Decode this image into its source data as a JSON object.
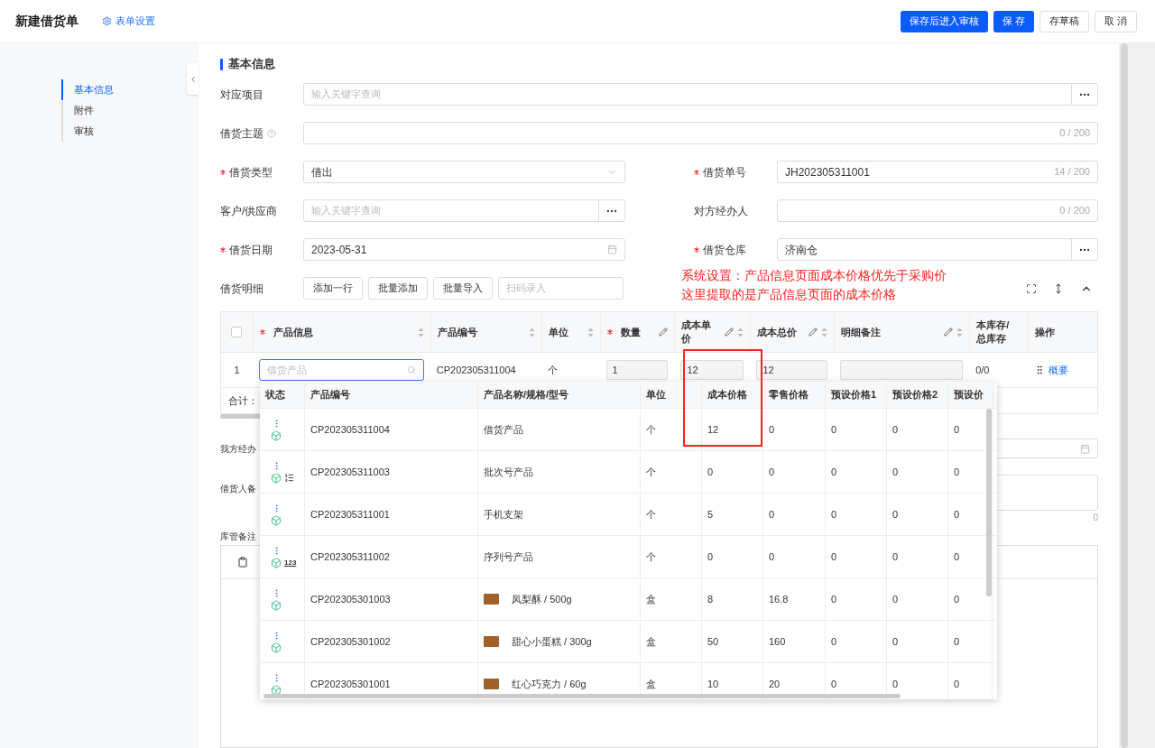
{
  "header": {
    "title": "新建借货单",
    "settings_link": "表单设置",
    "buttons": [
      {
        "label": "保存后进入审核",
        "kind": "primary"
      },
      {
        "label": "保 存",
        "kind": "primary"
      },
      {
        "label": "存草稿",
        "kind": "default"
      },
      {
        "label": "取 消",
        "kind": "default"
      }
    ]
  },
  "nav": {
    "items": [
      {
        "label": "基本信息",
        "selected": true
      },
      {
        "label": "附件",
        "selected": false
      },
      {
        "label": "审核",
        "selected": false
      }
    ]
  },
  "section_title": "基本信息",
  "project": {
    "label": "对应项目",
    "placeholder": "输入关键字查询"
  },
  "subject": {
    "label": "借货主题",
    "counter": "0 / 200"
  },
  "type": {
    "label": "借货类型",
    "required": true,
    "value": "借出"
  },
  "number": {
    "label": "借货单号",
    "required": true,
    "value": "JH202305311001",
    "counter": "14 / 200"
  },
  "customer": {
    "label": "客户/供应商",
    "required": false,
    "placeholder": "输入关键字查询"
  },
  "counterpart": {
    "label": "对方经办人",
    "required": false,
    "counter": "0 / 200"
  },
  "date": {
    "label": "借货日期",
    "required": true,
    "value": "2023-05-31"
  },
  "warehouse": {
    "label": "借货仓库",
    "required": true,
    "value": "济南仓"
  },
  "details": {
    "label": "借货明细",
    "buttons": [
      "添加一行",
      "批量添加",
      "批量导入"
    ],
    "scan_placeholder": "扫码录入"
  },
  "note": {
    "lines": [
      "系统设置：产品信息页面成本价格优先于采购价",
      "这里提取的是产品信息页面的成本价格"
    ]
  },
  "items_table": {
    "header_checkbox": {
      "checked": false
    },
    "columns": [
      {
        "label": "产品信息",
        "required": true,
        "sortable": true,
        "editable": false
      },
      {
        "label": "产品编号",
        "required": false,
        "sortable": true,
        "editable": false
      },
      {
        "label": "单位",
        "required": false,
        "sortable": true,
        "editable": false
      },
      {
        "label": "数量",
        "required": true,
        "sortable": false,
        "editable": true
      },
      {
        "label": "成本单价",
        "required": false,
        "sortable": true,
        "editable": true
      },
      {
        "label": "成本总价",
        "required": false,
        "sortable": true,
        "editable": true
      },
      {
        "label": "明细备注",
        "required": false,
        "sortable": true,
        "editable": true
      },
      {
        "label": "本库存/总库存",
        "required": false,
        "sortable": false,
        "editable": false
      },
      {
        "label": "操作",
        "required": false,
        "sortable": false,
        "editable": false
      }
    ],
    "rows": [
      {
        "index": "1",
        "product_placeholder": "借货产品",
        "code": "CP202305311004",
        "unit": "个",
        "quantity": "1",
        "unit_cost": "12",
        "total_cost": "12",
        "stock": "0/0",
        "action": "概要"
      }
    ],
    "total_label": "合计："
  },
  "our_handler": {
    "label": "我方经办"
  },
  "borrower_note": {
    "label": "借货人备",
    "counter": "0"
  },
  "keeper_note": {
    "label": "库管备注"
  },
  "picker": {
    "columns": [
      "状态",
      "产品编号",
      "产品名称/规格/型号",
      "单位",
      "成本价格",
      "零售价格",
      "预设价格1",
      "预设价格2",
      "预设价"
    ],
    "rows": [
      {
        "code": "CP202305311004",
        "name": "借货产品",
        "image": false,
        "unit": "个",
        "cost": "12",
        "retail": "0",
        "preset1": "0",
        "preset2": "0",
        "preset3": "0",
        "badge": {
          "kind": "none"
        }
      },
      {
        "code": "CP202305311003",
        "name": "批次号产品",
        "image": false,
        "unit": "个",
        "cost": "0",
        "retail": "0",
        "preset1": "0",
        "preset2": "0",
        "preset3": "0",
        "badge": {
          "kind": "batch"
        }
      },
      {
        "code": "CP202305311001",
        "name": "手机支架",
        "image": false,
        "unit": "个",
        "cost": "5",
        "retail": "0",
        "preset1": "0",
        "preset2": "0",
        "preset3": "0",
        "badge": {
          "kind": "none"
        }
      },
      {
        "code": "CP202305311002",
        "name": "序列号产品",
        "image": false,
        "unit": "个",
        "cost": "0",
        "retail": "0",
        "preset1": "0",
        "preset2": "0",
        "preset3": "0",
        "badge": {
          "kind": "serial",
          "text": "123"
        }
      },
      {
        "code": "CP202305301003",
        "name": "凤梨酥 / 500g",
        "image": true,
        "unit": "盒",
        "cost": "8",
        "retail": "16.8",
        "preset1": "0",
        "preset2": "0",
        "preset3": "0",
        "badge": {
          "kind": "none"
        }
      },
      {
        "code": "CP202305301002",
        "name": "甜心小蛋糕 / 300g",
        "image": true,
        "unit": "盒",
        "cost": "50",
        "retail": "160",
        "preset1": "0",
        "preset2": "0",
        "preset3": "0",
        "badge": {
          "kind": "none"
        }
      },
      {
        "code": "CP202305301001",
        "name": "红心巧克力 / 60g",
        "image": true,
        "unit": "盒",
        "cost": "10",
        "retail": "20",
        "preset1": "0",
        "preset2": "0",
        "preset3": "0",
        "badge": {
          "kind": "none"
        }
      }
    ]
  }
}
